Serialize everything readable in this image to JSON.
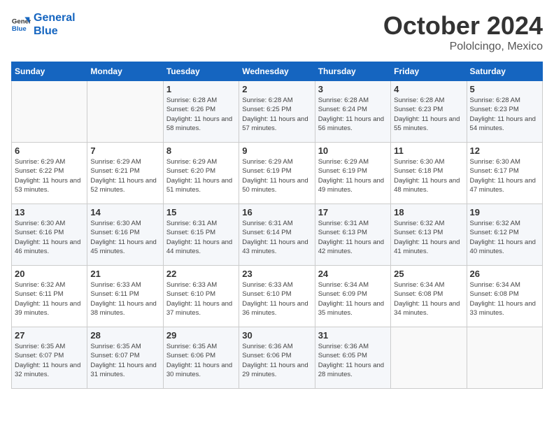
{
  "header": {
    "logo_line1": "General",
    "logo_line2": "Blue",
    "month": "October 2024",
    "location": "Pololcingo, Mexico"
  },
  "days_of_week": [
    "Sunday",
    "Monday",
    "Tuesday",
    "Wednesday",
    "Thursday",
    "Friday",
    "Saturday"
  ],
  "weeks": [
    [
      {
        "day": "",
        "info": ""
      },
      {
        "day": "",
        "info": ""
      },
      {
        "day": "1",
        "info": "Sunrise: 6:28 AM\nSunset: 6:26 PM\nDaylight: 11 hours and 58 minutes."
      },
      {
        "day": "2",
        "info": "Sunrise: 6:28 AM\nSunset: 6:25 PM\nDaylight: 11 hours and 57 minutes."
      },
      {
        "day": "3",
        "info": "Sunrise: 6:28 AM\nSunset: 6:24 PM\nDaylight: 11 hours and 56 minutes."
      },
      {
        "day": "4",
        "info": "Sunrise: 6:28 AM\nSunset: 6:23 PM\nDaylight: 11 hours and 55 minutes."
      },
      {
        "day": "5",
        "info": "Sunrise: 6:28 AM\nSunset: 6:23 PM\nDaylight: 11 hours and 54 minutes."
      }
    ],
    [
      {
        "day": "6",
        "info": "Sunrise: 6:29 AM\nSunset: 6:22 PM\nDaylight: 11 hours and 53 minutes."
      },
      {
        "day": "7",
        "info": "Sunrise: 6:29 AM\nSunset: 6:21 PM\nDaylight: 11 hours and 52 minutes."
      },
      {
        "day": "8",
        "info": "Sunrise: 6:29 AM\nSunset: 6:20 PM\nDaylight: 11 hours and 51 minutes."
      },
      {
        "day": "9",
        "info": "Sunrise: 6:29 AM\nSunset: 6:19 PM\nDaylight: 11 hours and 50 minutes."
      },
      {
        "day": "10",
        "info": "Sunrise: 6:29 AM\nSunset: 6:19 PM\nDaylight: 11 hours and 49 minutes."
      },
      {
        "day": "11",
        "info": "Sunrise: 6:30 AM\nSunset: 6:18 PM\nDaylight: 11 hours and 48 minutes."
      },
      {
        "day": "12",
        "info": "Sunrise: 6:30 AM\nSunset: 6:17 PM\nDaylight: 11 hours and 47 minutes."
      }
    ],
    [
      {
        "day": "13",
        "info": "Sunrise: 6:30 AM\nSunset: 6:16 PM\nDaylight: 11 hours and 46 minutes."
      },
      {
        "day": "14",
        "info": "Sunrise: 6:30 AM\nSunset: 6:16 PM\nDaylight: 11 hours and 45 minutes."
      },
      {
        "day": "15",
        "info": "Sunrise: 6:31 AM\nSunset: 6:15 PM\nDaylight: 11 hours and 44 minutes."
      },
      {
        "day": "16",
        "info": "Sunrise: 6:31 AM\nSunset: 6:14 PM\nDaylight: 11 hours and 43 minutes."
      },
      {
        "day": "17",
        "info": "Sunrise: 6:31 AM\nSunset: 6:13 PM\nDaylight: 11 hours and 42 minutes."
      },
      {
        "day": "18",
        "info": "Sunrise: 6:32 AM\nSunset: 6:13 PM\nDaylight: 11 hours and 41 minutes."
      },
      {
        "day": "19",
        "info": "Sunrise: 6:32 AM\nSunset: 6:12 PM\nDaylight: 11 hours and 40 minutes."
      }
    ],
    [
      {
        "day": "20",
        "info": "Sunrise: 6:32 AM\nSunset: 6:11 PM\nDaylight: 11 hours and 39 minutes."
      },
      {
        "day": "21",
        "info": "Sunrise: 6:33 AM\nSunset: 6:11 PM\nDaylight: 11 hours and 38 minutes."
      },
      {
        "day": "22",
        "info": "Sunrise: 6:33 AM\nSunset: 6:10 PM\nDaylight: 11 hours and 37 minutes."
      },
      {
        "day": "23",
        "info": "Sunrise: 6:33 AM\nSunset: 6:10 PM\nDaylight: 11 hours and 36 minutes."
      },
      {
        "day": "24",
        "info": "Sunrise: 6:34 AM\nSunset: 6:09 PM\nDaylight: 11 hours and 35 minutes."
      },
      {
        "day": "25",
        "info": "Sunrise: 6:34 AM\nSunset: 6:08 PM\nDaylight: 11 hours and 34 minutes."
      },
      {
        "day": "26",
        "info": "Sunrise: 6:34 AM\nSunset: 6:08 PM\nDaylight: 11 hours and 33 minutes."
      }
    ],
    [
      {
        "day": "27",
        "info": "Sunrise: 6:35 AM\nSunset: 6:07 PM\nDaylight: 11 hours and 32 minutes."
      },
      {
        "day": "28",
        "info": "Sunrise: 6:35 AM\nSunset: 6:07 PM\nDaylight: 11 hours and 31 minutes."
      },
      {
        "day": "29",
        "info": "Sunrise: 6:35 AM\nSunset: 6:06 PM\nDaylight: 11 hours and 30 minutes."
      },
      {
        "day": "30",
        "info": "Sunrise: 6:36 AM\nSunset: 6:06 PM\nDaylight: 11 hours and 29 minutes."
      },
      {
        "day": "31",
        "info": "Sunrise: 6:36 AM\nSunset: 6:05 PM\nDaylight: 11 hours and 28 minutes."
      },
      {
        "day": "",
        "info": ""
      },
      {
        "day": "",
        "info": ""
      }
    ]
  ]
}
